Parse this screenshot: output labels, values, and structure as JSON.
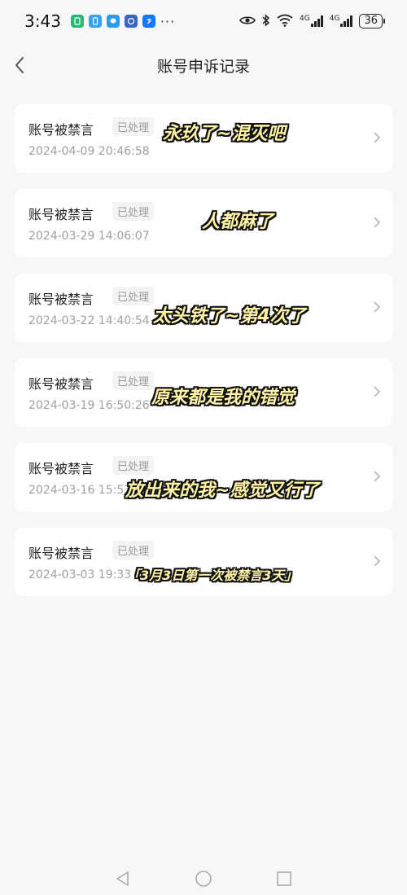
{
  "status_bar": {
    "time": "3:43",
    "dots": "···",
    "network_1": "4G",
    "network_2": "4G",
    "battery": "36"
  },
  "header": {
    "title": "账号申诉记录"
  },
  "records": [
    {
      "title": "账号被禁言",
      "status": "已处理",
      "time": "2024-04-09 20:46:58",
      "caption": "永玖了~混灭吧"
    },
    {
      "title": "账号被禁言",
      "status": "已处理",
      "time": "2024-03-29 14:06:07",
      "caption": "人都麻了"
    },
    {
      "title": "账号被禁言",
      "status": "已处理",
      "time": "2024-03-22 14:40:54",
      "caption": "太头铁了~第4次了"
    },
    {
      "title": "账号被禁言",
      "status": "已处理",
      "time": "2024-03-19 16:50:26",
      "caption": "原来都是我的错觉"
    },
    {
      "title": "账号被禁言",
      "status": "已处理",
      "time": "2024-03-16 15:53",
      "caption": "放出来的我~感觉又行了"
    },
    {
      "title": "账号被禁言",
      "status": "已处理",
      "time": "2024-03-03 19:33",
      "caption": "「3月3日第一次被禁言3天」"
    }
  ],
  "colors": {
    "background": "#f7f7f7",
    "card": "#ffffff",
    "badge_bg": "#f4f4f4",
    "caption_fill": "#fff3a8"
  }
}
